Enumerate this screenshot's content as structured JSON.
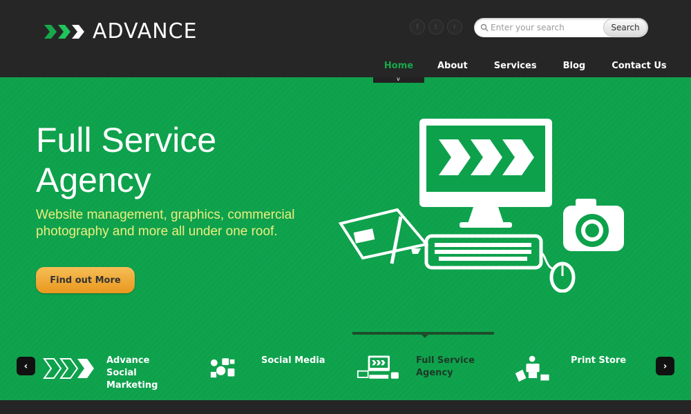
{
  "brand": {
    "name": "ADVANCE",
    "accent": "#17a84a"
  },
  "social": [
    {
      "icon": "facebook-icon",
      "glyph": "f"
    },
    {
      "icon": "twitter-icon",
      "glyph": "t"
    },
    {
      "icon": "rss-icon",
      "glyph": "r"
    }
  ],
  "search": {
    "placeholder": "Enter your search",
    "button_label": "Search"
  },
  "nav": {
    "items": [
      "Home",
      "About",
      "Services",
      "Blog",
      "Contact Us"
    ],
    "active": "Home"
  },
  "hero": {
    "title": "Full Service Agency",
    "subtitle": "Website management, graphics, commercial photography and more all under one roof.",
    "cta_label": "Find out More"
  },
  "slider": {
    "prev_glyph": "‹",
    "next_glyph": "›",
    "items": [
      {
        "label": "Advance Social Marketing",
        "icon": "advance-chevrons-icon"
      },
      {
        "label": "Social Media",
        "icon": "social-media-icon"
      },
      {
        "label": "Full Service Agency",
        "icon": "computer-icon",
        "active": true
      },
      {
        "label": "Print Store",
        "icon": "print-store-icon"
      }
    ]
  }
}
